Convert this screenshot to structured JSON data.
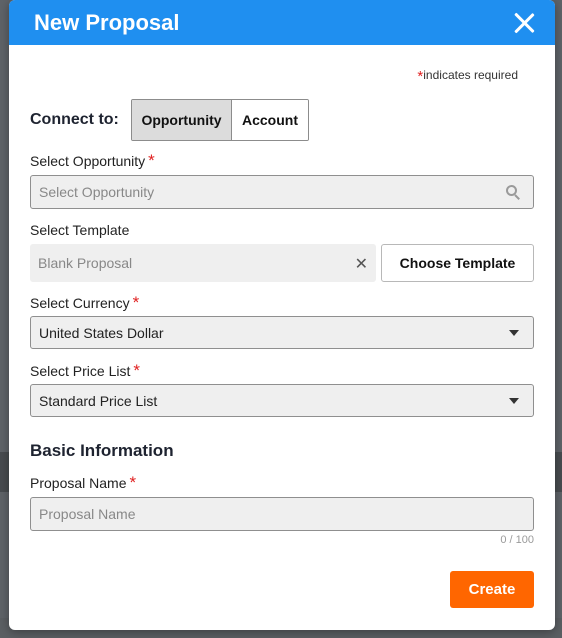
{
  "modal": {
    "title": "New Proposal",
    "required_note": "indicates required",
    "connect": {
      "label": "Connect to:",
      "options": [
        "Opportunity",
        "Account"
      ],
      "selected": "Opportunity"
    },
    "opportunity": {
      "label": "Select Opportunity",
      "placeholder": "Select Opportunity"
    },
    "template": {
      "label": "Select Template",
      "value": "Blank Proposal",
      "choose_button": "Choose Template"
    },
    "currency": {
      "label": "Select Currency",
      "value": "United States Dollar"
    },
    "price_list": {
      "label": "Select Price List",
      "value": "Standard Price List"
    },
    "basic_info": {
      "title": "Basic Information"
    },
    "proposal_name": {
      "label": "Proposal Name",
      "placeholder": "Proposal Name",
      "counter": "0 / 100"
    },
    "create_button": "Create"
  },
  "colors": {
    "header": "#1f8ff0",
    "accent_button": "#ff6600",
    "required_star": "#e02020"
  },
  "icons": {
    "close": "close-icon",
    "search": "search-icon",
    "clear": "clear-icon",
    "dropdown": "chevron-down-icon"
  }
}
